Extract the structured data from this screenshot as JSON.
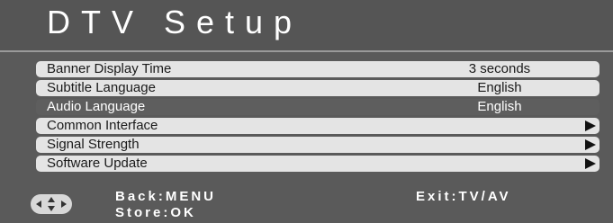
{
  "title": "DTV Setup",
  "menu": {
    "items": [
      {
        "label": "Banner Display Time",
        "value": "3 seconds"
      },
      {
        "label": "Subtitle Language",
        "value": "English"
      },
      {
        "label": "Audio Language",
        "value": "English"
      },
      {
        "label": "Common Interface",
        "value": ""
      },
      {
        "label": "Signal Strength",
        "value": ""
      },
      {
        "label": "Software Update",
        "value": ""
      }
    ]
  },
  "footer": {
    "back": "Back:MENU",
    "store": "Store:OK",
    "exit": "Exit:TV/AV"
  },
  "colors": {
    "background": "#5a5a5a",
    "row": "#e4e4e4",
    "row_selected": "#5e5e5e",
    "text_light": "#ffffff",
    "text_dark": "#1a1a1a"
  },
  "icons": {
    "navigation": "arrow-keys-icon",
    "submenu": "triangle-right-icon"
  }
}
